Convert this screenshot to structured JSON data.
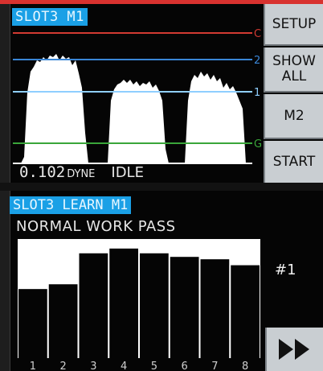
{
  "monitor": {
    "title": "SLOT3 M1",
    "limit_labels": {
      "c": "C",
      "two": "2",
      "one": "1",
      "g": "G"
    },
    "readout_value": "0.102",
    "readout_unit": "DYNE",
    "status": "IDLE",
    "buttons": {
      "setup": "SETUP",
      "show_all_line1": "SHOW",
      "show_all_line2": "ALL",
      "m2": "M2",
      "start": "START"
    },
    "colors": {
      "c_line": "#d23a32",
      "two_line": "#3a86d6",
      "one_line": "#8fcfff",
      "g_line": "#3aa63a",
      "title_bg": "#1aa0e6"
    }
  },
  "learn": {
    "title": "SLOT3 LEARN M1",
    "subtitle": "NORMAL WORK PASS",
    "pass_label": "#1",
    "next_icon": "fast-forward-icon",
    "chart_data": {
      "type": "bar",
      "categories": [
        "1",
        "2",
        "3",
        "4",
        "5",
        "6",
        "7",
        "8"
      ],
      "values": [
        58,
        62,
        88,
        92,
        88,
        85,
        83,
        78
      ],
      "ylim": [
        0,
        100
      ],
      "xlabel": "",
      "ylabel": ""
    }
  }
}
